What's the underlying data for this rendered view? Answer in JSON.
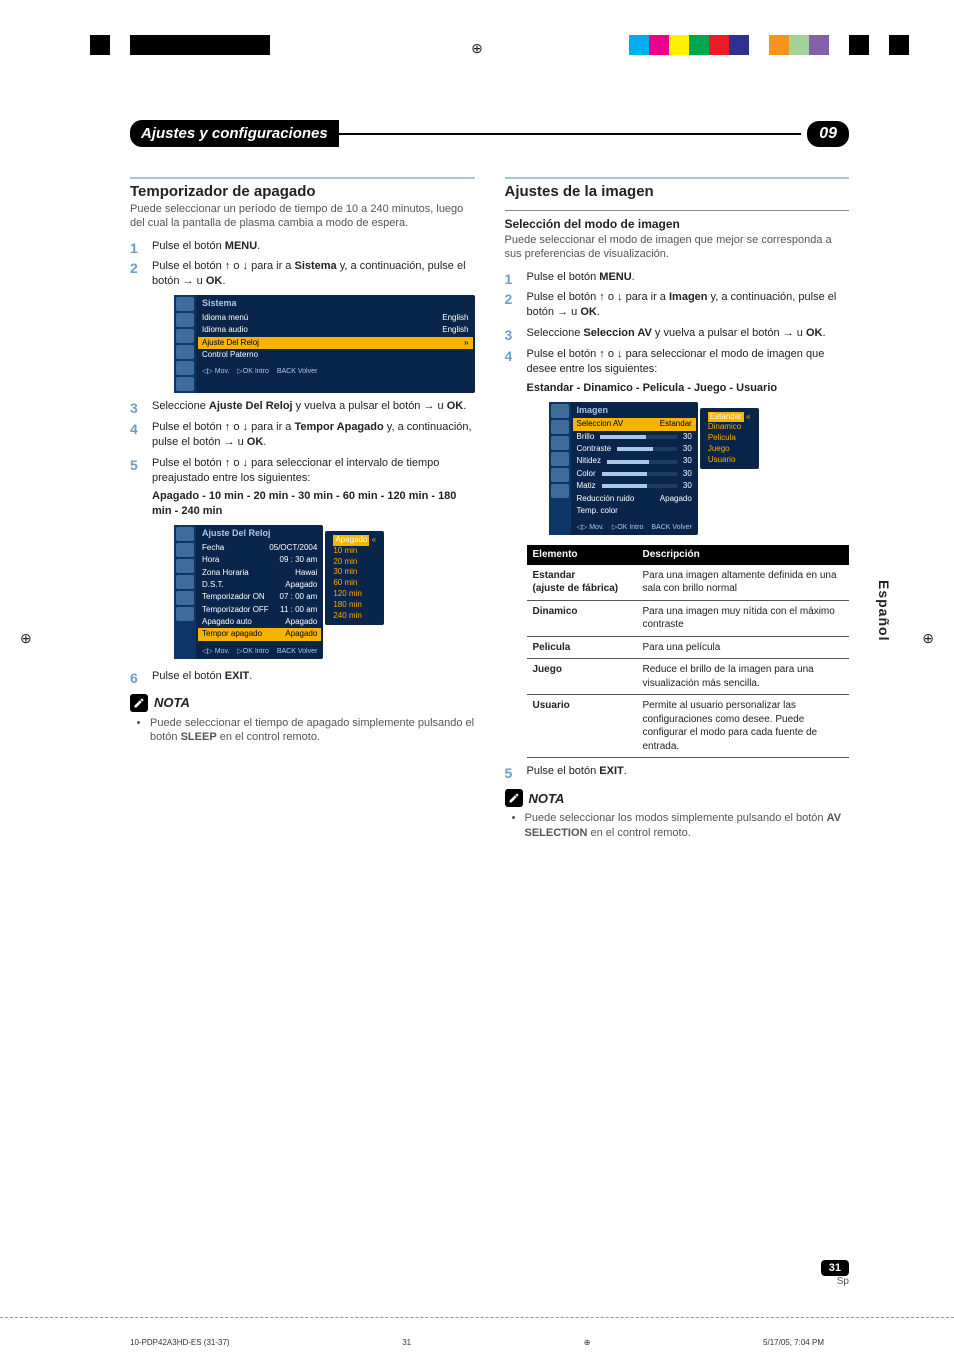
{
  "header": {
    "title": "Ajustes y configuraciones",
    "chapter": "09"
  },
  "side_tab": "Español",
  "left": {
    "h2": "Temporizador de apagado",
    "intro": "Puede seleccionar un período de tiempo de 10 a 240 minutos, luego del cual la pantalla de plasma cambia a modo de espera.",
    "steps": {
      "s1_a": "Pulse el botón ",
      "s1_b": "MENU",
      "s1_c": ".",
      "s2_a": "Pulse el botón ",
      "s2_b": " o ",
      "s2_c": " para ir a ",
      "s2_d": "Sistema",
      "s2_e": " y, a continuación, pulse el botón ",
      "s2_f": " u ",
      "s2_g": "OK",
      "s2_h": ".",
      "s3_a": "Seleccione ",
      "s3_b": "Ajuste Del Reloj",
      "s3_c": " y vuelva a pulsar el botón ",
      "s3_d": " u ",
      "s3_e": "OK",
      "s3_f": ".",
      "s4_a": "Pulse el botón ",
      "s4_b": " o ",
      "s4_c": " para ir a ",
      "s4_d": "Tempor Apagado",
      "s4_e": " y, a continuación, pulse el botón ",
      "s4_f": " u ",
      "s4_g": "OK",
      "s4_h": ".",
      "s5_a": "Pulse el botón ",
      "s5_b": " o ",
      "s5_c": " para seleccionar el intervalo de tiempo preajustado entre los siguientes:",
      "s5_modes": "Apagado - 10 min - 20 min - 30 min - 60 min - 120 min - 180 min - 240 min",
      "s6_a": "Pulse el botón ",
      "s6_b": "EXIT",
      "s6_c": "."
    },
    "osd1": {
      "title": "Sistema",
      "rows": [
        {
          "l": "Idioma menú",
          "r": "English"
        },
        {
          "l": "Idioma audio",
          "r": "English"
        },
        {
          "l": "Ajuste Del Reloj",
          "r": "»",
          "hl": true
        },
        {
          "l": "Control Paterno",
          "r": ""
        }
      ],
      "foot": {
        "mov": "Mov.",
        "intro": "Intro",
        "back": "Volver"
      }
    },
    "osd2": {
      "title": "Ajuste Del Reloj",
      "rows": [
        {
          "l": "Fecha",
          "r": "05/OCT/2004"
        },
        {
          "l": "Hora",
          "r": "09 : 30 am"
        },
        {
          "l": "Zona Horaria",
          "r": "Hawai"
        },
        {
          "l": "D.S.T.",
          "r": "Apagado"
        },
        {
          "l": "Temporizador ON",
          "r": "07 : 00 am"
        },
        {
          "l": "Temporizador OFF",
          "r": "11 : 00 am"
        },
        {
          "l": "Apagado auto",
          "r": "Apagado"
        },
        {
          "l": "Tempor apagado",
          "r": "Apagado",
          "hl": true
        }
      ],
      "foot": {
        "mov": "Mov.",
        "intro": "Intro",
        "back": "Volver"
      },
      "popup": [
        "Apagado",
        "10 min",
        "20 min",
        "30 min",
        "60 min",
        "120 min",
        "180 min",
        "240 min"
      ]
    },
    "note_title": "NOTA",
    "note_items": [
      {
        "a": "Puede seleccionar el tiempo de apagado simplemente pulsando el botón ",
        "b": "SLEEP",
        "c": " en el control remoto."
      }
    ]
  },
  "right": {
    "h2": "Ajustes de la imagen",
    "h3": "Selección del modo de imagen",
    "intro": "Puede seleccionar el modo de imagen que mejor se corresponda a sus preferencias de visualización.",
    "steps": {
      "s1_a": "Pulse el botón ",
      "s1_b": "MENU",
      "s1_c": ".",
      "s2_a": "Pulse el botón ",
      "s2_b": " o ",
      "s2_c": " para ir a ",
      "s2_d": "Imagen",
      "s2_e": " y, a continuación, pulse el botón ",
      "s2_f": " u ",
      "s2_g": "OK",
      "s2_h": ".",
      "s3_a": "Seleccione ",
      "s3_b": "Seleccion AV",
      "s3_c": " y vuelva a pulsar el botón ",
      "s3_d": " u ",
      "s3_e": "OK",
      "s3_f": ".",
      "s4_a": "Pulse el botón ",
      "s4_b": " o ",
      "s4_c": " para seleccionar el modo de imagen que desee entre los siguientes:",
      "s4_modes": "Estandar - Dinamico - Pelicula - Juego - Usuario",
      "s5_a": "Pulse el botón ",
      "s5_b": "EXIT",
      "s5_c": "."
    },
    "osd": {
      "title": "Imagen",
      "rows": [
        {
          "l": "Seleccion AV",
          "r": "Estandar",
          "hl": true
        },
        {
          "l": "Brillo",
          "r": "30"
        },
        {
          "l": "Contraste",
          "r": "30"
        },
        {
          "l": "Nitidez",
          "r": "30"
        },
        {
          "l": "Color",
          "r": "30"
        },
        {
          "l": "Matiz",
          "r": "30"
        },
        {
          "l": "Reducción ruido",
          "r": "Apagado"
        },
        {
          "l": "Temp. color",
          "r": ""
        }
      ],
      "foot": {
        "mov": "Mov.",
        "intro": "Intro",
        "back": "Volver"
      },
      "popup": [
        "Estandar",
        "Dinamico",
        "Pelicula",
        "Juego",
        "Usuario"
      ]
    },
    "table": {
      "h1": "Elemento",
      "h2": "Descripción",
      "rows": [
        {
          "el": "Estandar",
          "sub": "(ajuste de fábrica)",
          "d": "Para una imagen altamente definida en una sala con brillo normal"
        },
        {
          "el": "Dinamico",
          "d": "Para una imagen muy nítida con el máximo contraste"
        },
        {
          "el": "Pelicula",
          "d": "Para una película"
        },
        {
          "el": "Juego",
          "d": "Reduce el brillo de la imagen para una visualización más sencilla."
        },
        {
          "el": "Usuario",
          "d": "Permite al usuario personalizar las configuraciones como desee. Puede configurar el modo para cada fuente de entrada."
        }
      ]
    },
    "note_title": "NOTA",
    "note_items": [
      {
        "a": "Puede seleccionar los modos simplemente pulsando el botón ",
        "b": "AV SELECTION",
        "c": " en el control remoto."
      }
    ]
  },
  "page": {
    "num": "31",
    "lang": "Sp"
  },
  "footer": {
    "file": "10-PDP42A3HD-ES (31-37)",
    "pg": "31",
    "ts": "5/17/05, 7:04 PM"
  }
}
